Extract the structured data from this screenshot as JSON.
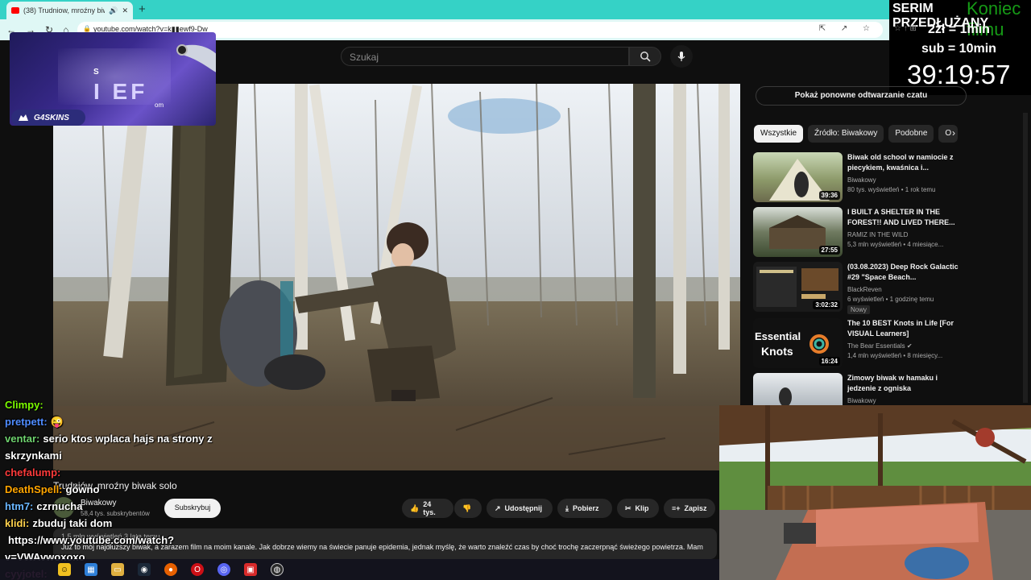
{
  "browser": {
    "tab_title": "(38) Trudniow, mroźny biw",
    "tab_audio": "🔊",
    "tab_close": "✕",
    "new_tab": "+",
    "url": "youtube.com/watch?v=k▮▮ewf9-Dw"
  },
  "sponsor": {
    "name": "G4SKINS",
    "letters": "I EF",
    "small_s": "S",
    "small_om": "om"
  },
  "stream_timer": {
    "title": "SERIM PRZEDŁUŻANY",
    "ghost_text": "Koniec filmu",
    "rate_donation": "2zł = 1min",
    "rate_sub": "sub = 10min",
    "countdown": "39:19:57"
  },
  "youtube": {
    "search_placeholder": "Szukaj",
    "replay_button": "Pokaż ponowne odtwarzanie czatu",
    "chips": [
      "Wszystkie",
      "Źródło: Biwakowy",
      "Podobne",
      "O"
    ],
    "recommendations": [
      {
        "title": "Biwak old school w namiocie z piecykiem, kwaśnica i...",
        "channel": "Biwakowy",
        "meta": "80 tys. wyświetleń • 1 rok temu",
        "duration": "39:36"
      },
      {
        "title": "I BUILT A SHELTER IN THE FOREST!! AND LIVED THERE...",
        "channel": "RAMIZ IN THE WILD",
        "meta": "5,3 mln wyświetleń • 4 miesiące...",
        "duration": "27:55"
      },
      {
        "title": "(03.08.2023) Deep Rock Galactic #29 \"Space Beach...",
        "channel": "BlackReven",
        "meta": "6 wyświetleń • 1 godzinę temu",
        "duration": "3:02:32",
        "badge": "Nowy"
      },
      {
        "title": "The 10 BEST Knots in Life [For VISUAL Learners]",
        "channel": "The Bear Essentials ✔",
        "meta": "1,4 mln wyświetleń • 8 miesięcy...",
        "duration": "16:24",
        "thumb_text_1": "Essential",
        "thumb_text_2": "Knots"
      },
      {
        "title": "Zimowy biwak w hamaku i jedzenie z ogniska",
        "channel": "Biwakowy",
        "meta": "",
        "duration": ""
      }
    ],
    "video_title": "Trudniów, mroźny biwak solo",
    "channel_name": "Biwakowy",
    "subscribers": "58,4 tys. subskrybentów",
    "subscribe_label": "Subskrybuj",
    "likes": "24 tys.",
    "share_label": "Udostępnij",
    "download_label": "Pobierz",
    "clip_label": "Klip",
    "save_label": "Zapisz",
    "description_meta": "1,5 mln wyświetleń  3 lata temu",
    "description_text": "Już to mój najdłuższy biwak, a zarazem film na moim kanale. Jak dobrze wiemy na świecie panuje epidemia, jednak myślę, że warto znaleźć czas by choć trochę zaczerpnąć świeżego powietrza. Mam"
  },
  "chat": [
    {
      "user": "Clìmpy:",
      "text": "",
      "color": "#7CFC00"
    },
    {
      "user": "pretpett:",
      "text": "😜",
      "color": "#4F8CFF"
    },
    {
      "user": "ventar:",
      "text": "serio ktos wplaca hajs na strony z skrzynkami",
      "color": "#6FD36F"
    },
    {
      "user": "chefalump:",
      "text": "",
      "color": "#FF3B3B"
    },
    {
      "user": "DeathSpell:",
      "text": "gówno",
      "color": "#FFA500"
    },
    {
      "user": "htm7:",
      "text": "czrnucha",
      "color": "#6AB7FF"
    },
    {
      "user": "klidi:",
      "text": "zbuduj taki dom",
      "color": "#FFD24D"
    },
    {
      "user": "",
      "text": "https://www.youtube.com/watch?v=VWAvwoxoxo",
      "color": "#ffffff"
    },
    {
      "user": "cyyjotel:",
      "text": "",
      "color": "#FF66CC"
    }
  ],
  "taskbar_icons": [
    "start-icon",
    "explorer-icon",
    "files-icon",
    "steam-icon",
    "firefox-icon",
    "opera-icon",
    "discord-icon",
    "app-icon",
    "obs-icon"
  ]
}
